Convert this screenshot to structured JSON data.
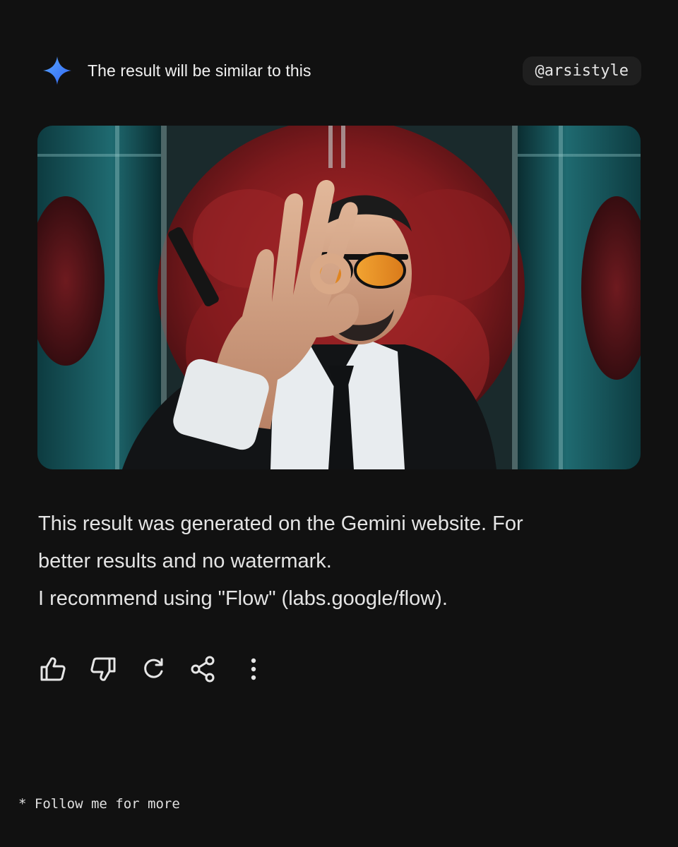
{
  "header": {
    "title": "The result will be similar to this",
    "handle": "@arsistyle",
    "logo_icon": "gemini-sparkle-icon",
    "logo_colors": [
      "#4a9bff",
      "#3b6cf5"
    ]
  },
  "result_image": {
    "subject": "man in suit with orange sunglasses making OK hand gesture in elevator with meat behind glass",
    "dominant_colors": [
      "#0f4a4e",
      "#8a1f22",
      "#1a1a1a",
      "#e2a035"
    ]
  },
  "message": {
    "lines": [
      "This result was generated on the Gemini website. For",
      "better results and no watermark.",
      "I recommend using \"Flow\" (labs.google/flow)."
    ]
  },
  "actions": [
    {
      "name": "thumbs-up-icon"
    },
    {
      "name": "thumbs-down-icon"
    },
    {
      "name": "regenerate-icon"
    },
    {
      "name": "share-icon"
    },
    {
      "name": "more-vertical-icon"
    }
  ],
  "footer": {
    "text": "* Follow me for more"
  },
  "colors": {
    "background": "#111111",
    "text": "#e4e4e4",
    "pill": "#1f1f1f"
  }
}
